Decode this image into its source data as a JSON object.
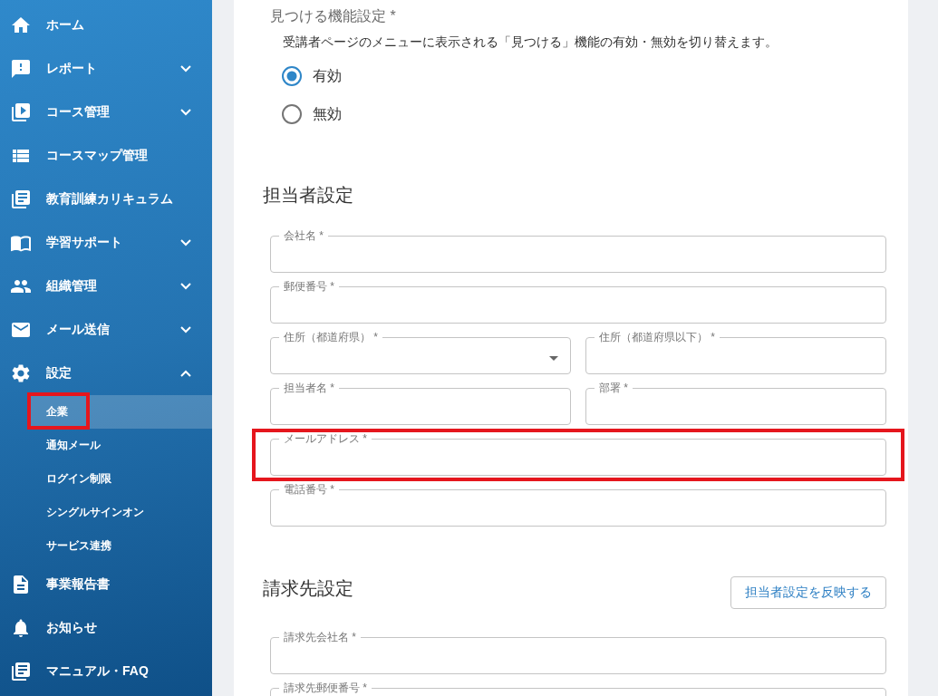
{
  "sidebar": {
    "items": [
      {
        "kind": "link",
        "label": "ホーム"
      },
      {
        "kind": "group",
        "label": "レポート",
        "expanded": false
      },
      {
        "kind": "group",
        "label": "コース管理",
        "expanded": false
      },
      {
        "kind": "link",
        "label": "コースマップ管理"
      },
      {
        "kind": "link",
        "label": "教育訓練カリキュラム"
      },
      {
        "kind": "group",
        "label": "学習サポート",
        "expanded": false
      },
      {
        "kind": "group",
        "label": "組織管理",
        "expanded": false
      },
      {
        "kind": "group",
        "label": "メール送信",
        "expanded": false
      },
      {
        "kind": "group",
        "label": "設定",
        "expanded": true,
        "children": [
          {
            "label": "企業",
            "selected": true,
            "highlighted": true
          },
          {
            "label": "通知メール",
            "selected": false,
            "highlighted": false
          },
          {
            "label": "ログイン制限",
            "selected": false,
            "highlighted": false
          },
          {
            "label": "シングルサインオン",
            "selected": false,
            "highlighted": false
          },
          {
            "label": "サービス連携",
            "selected": false,
            "highlighted": false
          }
        ]
      },
      {
        "kind": "link",
        "label": "事業報告書"
      },
      {
        "kind": "link",
        "label": "お知らせ"
      },
      {
        "kind": "link",
        "label": "マニュアル・FAQ"
      }
    ]
  },
  "discover_setting": {
    "label": "見つける機能設定 *",
    "description": "受講者ページのメニューに表示される「見つける」機能の有効・無効を切り替えます。",
    "options": [
      {
        "label": "有効",
        "selected": true
      },
      {
        "label": "無効",
        "selected": false
      }
    ]
  },
  "sections": [
    {
      "title": "担当者設定",
      "rows": [
        [
          {
            "kind": "text",
            "label": "会社名 *",
            "highlighted": false
          }
        ],
        [
          {
            "kind": "text",
            "label": "郵便番号 *",
            "highlighted": false
          }
        ],
        [
          {
            "kind": "select",
            "label": "住所（都道府県） *",
            "highlighted": false
          },
          {
            "kind": "text",
            "label": "住所（都道府県以下） *",
            "highlighted": false
          }
        ],
        [
          {
            "kind": "text",
            "label": "担当者名 *",
            "highlighted": false
          },
          {
            "kind": "text",
            "label": "部署 *",
            "highlighted": false
          }
        ],
        [
          {
            "kind": "text",
            "label": "メールアドレス *",
            "highlighted": true
          }
        ],
        [
          {
            "kind": "text",
            "label": "電話番号 *",
            "highlighted": false
          }
        ]
      ]
    },
    {
      "title": "請求先設定",
      "button": "担当者設定を反映する",
      "rows": [
        [
          {
            "kind": "text",
            "label": "請求先会社名 *",
            "highlighted": false
          }
        ],
        [
          {
            "kind": "text",
            "label": "請求先郵便番号 *",
            "highlighted": false
          }
        ]
      ]
    }
  ]
}
